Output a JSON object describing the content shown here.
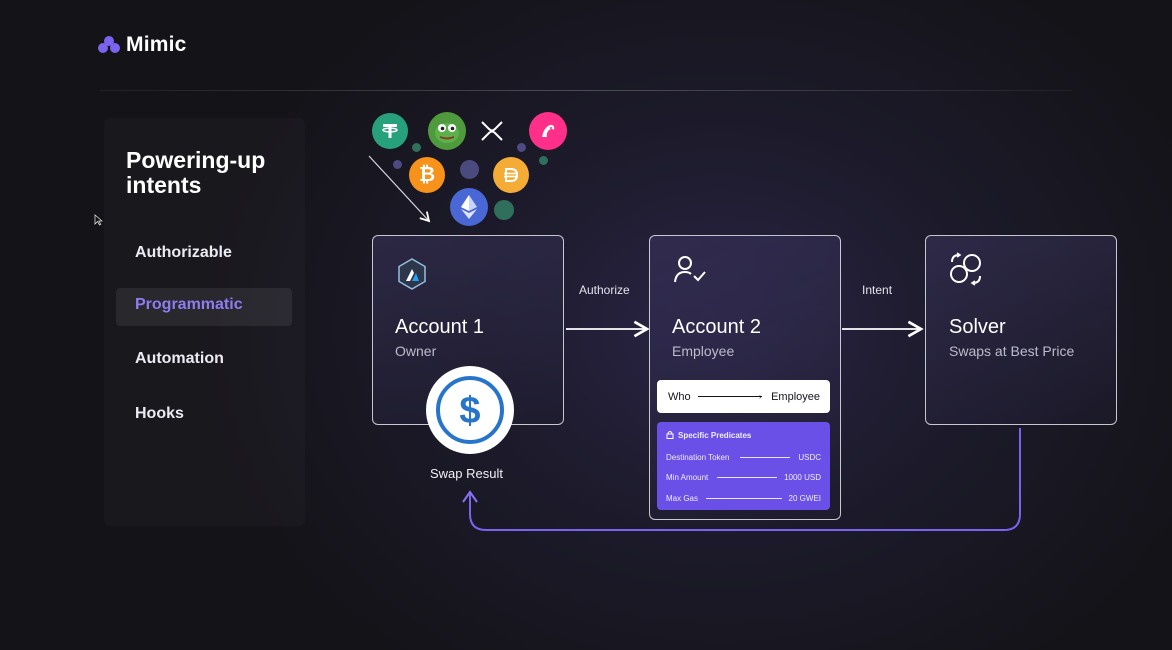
{
  "brand": {
    "name": "Mimic",
    "accent": "#7b63f0"
  },
  "sidebar": {
    "title": "Powering-up intents",
    "items": [
      {
        "label": "Authorizable",
        "active": false
      },
      {
        "label": "Programmatic",
        "active": true
      },
      {
        "label": "Automation",
        "active": false
      },
      {
        "label": "Hooks",
        "active": false
      }
    ]
  },
  "tokens": [
    {
      "icon": "tether-icon",
      "color": "#26a17b"
    },
    {
      "icon": "pepe-icon",
      "color": "#3d8a33"
    },
    {
      "icon": "xrp-icon",
      "color": "#ffffff"
    },
    {
      "icon": "uniswap-icon",
      "color": "#ff007a"
    },
    {
      "icon": "bitcoin-icon",
      "color": "#f7931a"
    },
    {
      "icon": "dai-icon",
      "color": "#f5ac37"
    },
    {
      "icon": "ethereum-icon",
      "color": "#627eea"
    }
  ],
  "flow": {
    "authorize_label": "Authorize",
    "intent_label": "Intent",
    "account1": {
      "title": "Account 1",
      "subtitle": "Owner",
      "icon": "arbitrum-icon"
    },
    "account2": {
      "title": "Account 2",
      "subtitle": "Employee",
      "icon": "user-check-icon"
    },
    "solver": {
      "title": "Solver",
      "subtitle": "Swaps at Best Price",
      "icon": "swap-coins-icon"
    },
    "who": {
      "key": "Who",
      "value": "Employee"
    },
    "predicates": {
      "title": "Specific Predicates",
      "rows": [
        {
          "key": "Destination Token",
          "value": "USDC"
        },
        {
          "key": "Min Amount",
          "value": "1000 USD"
        },
        {
          "key": "Max Gas",
          "value": "20 GWEI"
        }
      ]
    },
    "swap_result_label": "Swap Result",
    "usdc_icon": "usdc-icon"
  }
}
